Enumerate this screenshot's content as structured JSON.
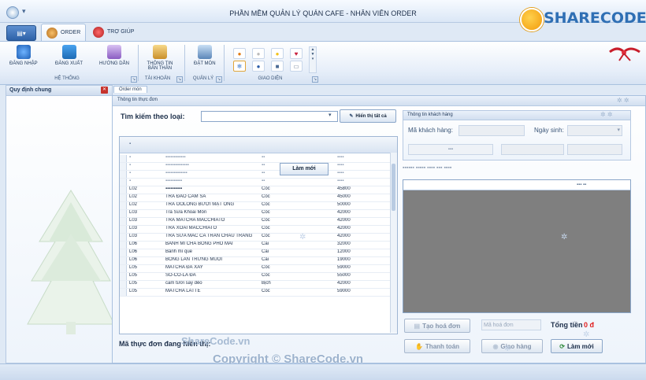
{
  "window": {
    "title": "PHẦN MỀM QUẢN LÝ QUÁN CAFE - NHÂN VIÊN ORDER"
  },
  "brand": {
    "logo_text": "SHARECODE.vn"
  },
  "tabs": [
    {
      "label": "ORDER"
    },
    {
      "label": "TRỢ GIÚP"
    }
  ],
  "ribbon": {
    "he_thong": {
      "label": "HỆ THỐNG",
      "buttons": [
        "ĐĂNG NHẬP",
        "ĐĂNG XUẤT",
        "HƯỚNG DẪN"
      ]
    },
    "tai_khoan": {
      "label": "TÀI KHOẢN",
      "buttons": [
        "THÔNG TIN BẢN THÂN"
      ]
    },
    "quan_ly": {
      "label": "QUẢN LÝ",
      "buttons": [
        "ĐẶT MÓN"
      ]
    },
    "giao_dien": {
      "label": "GIAO DIỆN"
    }
  },
  "left_panel": {
    "title": "Quy định chung"
  },
  "doc_tab": "Order món",
  "menu_group": {
    "title": "Thông tin thực đơn",
    "search_label": "Tìm kiếm theo loại:",
    "show_all": "Hiển thị tất cả",
    "code_label": "Mã thực đơn đang hiển thị:",
    "rows": [
      {
        "code": "L02",
        "name": "TRÀ ĐÀO CAM SẢ",
        "unit": "Cốc",
        "price": "45000"
      },
      {
        "code": "L02",
        "name": "TRÀ OOLONG BƯỞI MẬT ONG",
        "unit": "Cốc",
        "price": "50000"
      },
      {
        "code": "L03",
        "name": "Trà Sữa Khoai Môn",
        "unit": "Cốc",
        "price": "42000"
      },
      {
        "code": "L03",
        "name": "TRÀ MATCHA MACCHIATO",
        "unit": "Cốc",
        "price": "42000"
      },
      {
        "code": "L03",
        "name": "TRÀ XOÀI MACCHIATO",
        "unit": "Cốc",
        "price": "42000"
      },
      {
        "code": "L03",
        "name": "TRÀ SỮA MẮC CA TRÂN CHÂU TRẮNG",
        "unit": "Cốc",
        "price": "42000"
      },
      {
        "code": "L06",
        "name": "BÁNH MÌ CHÀ BÔNG PHÔ MAI",
        "unit": "Cái",
        "price": "32000"
      },
      {
        "code": "L06",
        "name": "Bánh mì que",
        "unit": "Cái",
        "price": "12000"
      },
      {
        "code": "L06",
        "name": "BÔNG LAN TRỨNG MUỐI",
        "unit": "Cái",
        "price": "19000"
      },
      {
        "code": "L05",
        "name": "MATCHA ĐÁ XAY",
        "unit": "Cốc",
        "price": "59000"
      },
      {
        "code": "L05",
        "name": "SÔ-CÔ-LA ĐÁ",
        "unit": "Cốc",
        "price": "55000"
      },
      {
        "code": "L05",
        "name": "cam tươi sấy dẻo",
        "unit": "Bịch",
        "price": "42000"
      },
      {
        "code": "L05",
        "name": "MATCHA LATTE",
        "unit": "Cốc",
        "price": "59000"
      }
    ],
    "partial_prices": [
      "45800"
    ]
  },
  "customer": {
    "title": "Thông tin khách hàng",
    "ma_label": "Mã khách hàng:",
    "dob_label": "Ngày sinh:"
  },
  "order": {
    "add_button": "Làm mới",
    "create_button": "Tạo hoá đơn",
    "code_placeholder": "Mã hoá đơn",
    "total_label": "Tổng tiền",
    "total_value": "0 đ",
    "pay_button": "Thanh toán",
    "deliver_button": "Giao hàng",
    "refresh_button": "Làm mới"
  },
  "watermark": {
    "copyright": "Copyright © ShareCode.vn",
    "sharecode": "ShareCode.vn"
  },
  "colors": {
    "accent": "#2f6fb4",
    "total": "#e02020"
  }
}
